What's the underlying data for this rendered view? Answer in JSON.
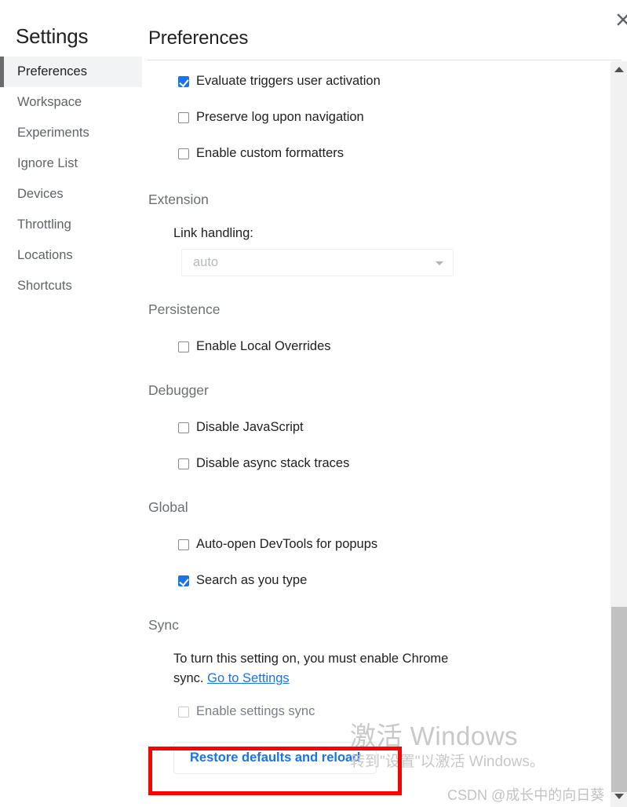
{
  "sidebar": {
    "title": "Settings",
    "items": [
      {
        "label": "Preferences",
        "selected": true
      },
      {
        "label": "Workspace",
        "selected": false
      },
      {
        "label": "Experiments",
        "selected": false
      },
      {
        "label": "Ignore List",
        "selected": false
      },
      {
        "label": "Devices",
        "selected": false
      },
      {
        "label": "Throttling",
        "selected": false
      },
      {
        "label": "Locations",
        "selected": false
      },
      {
        "label": "Shortcuts",
        "selected": false
      }
    ]
  },
  "panel": {
    "title": "Preferences",
    "close_icon": "close-icon"
  },
  "console_options": [
    {
      "label": "Evaluate triggers user activation",
      "checked": true,
      "disabled": false
    },
    {
      "label": "Preserve log upon navigation",
      "checked": false,
      "disabled": false
    },
    {
      "label": "Enable custom formatters",
      "checked": false,
      "disabled": false
    }
  ],
  "extension": {
    "header": "Extension",
    "link_handling_label": "Link handling:",
    "link_handling_value": "auto",
    "link_handling_options": [
      "auto"
    ],
    "disabled": true
  },
  "persistence": {
    "header": "Persistence",
    "options": [
      {
        "label": "Enable Local Overrides",
        "checked": false,
        "disabled": false
      }
    ]
  },
  "debugger": {
    "header": "Debugger",
    "options": [
      {
        "label": "Disable JavaScript",
        "checked": false,
        "disabled": false
      },
      {
        "label": "Disable async stack traces",
        "checked": false,
        "disabled": false
      }
    ]
  },
  "global": {
    "header": "Global",
    "options": [
      {
        "label": "Auto-open DevTools for popups",
        "checked": false,
        "disabled": false
      },
      {
        "label": "Search as you type",
        "checked": true,
        "disabled": false
      }
    ]
  },
  "sync": {
    "header": "Sync",
    "note_text": "To turn this setting on, you must enable Chrome sync. ",
    "note_link": "Go to Settings",
    "options": [
      {
        "label": "Enable settings sync",
        "checked": false,
        "disabled": true
      }
    ]
  },
  "restore": {
    "label": "Restore defaults and reload"
  },
  "scrollbar": {
    "up_arrow_icon": "triangle-up-icon",
    "down_arrow_icon": "triangle-down-icon"
  },
  "watermark": {
    "line1": "激活 Windows",
    "line2": "转到\"设置\"以激活 Windows。",
    "csdn": "CSDN @成长中的向日葵"
  },
  "colors": {
    "accent": "#1a73e8",
    "annotation": "#ff0000",
    "section_header": "#6b6f73",
    "sidebar_selected_bg": "#f1f3f4",
    "sidebar_selected_bar": "#6b6b6b",
    "scrollbar_thumb": "#c1c1c1",
    "watermark": "#c8c8c8"
  }
}
